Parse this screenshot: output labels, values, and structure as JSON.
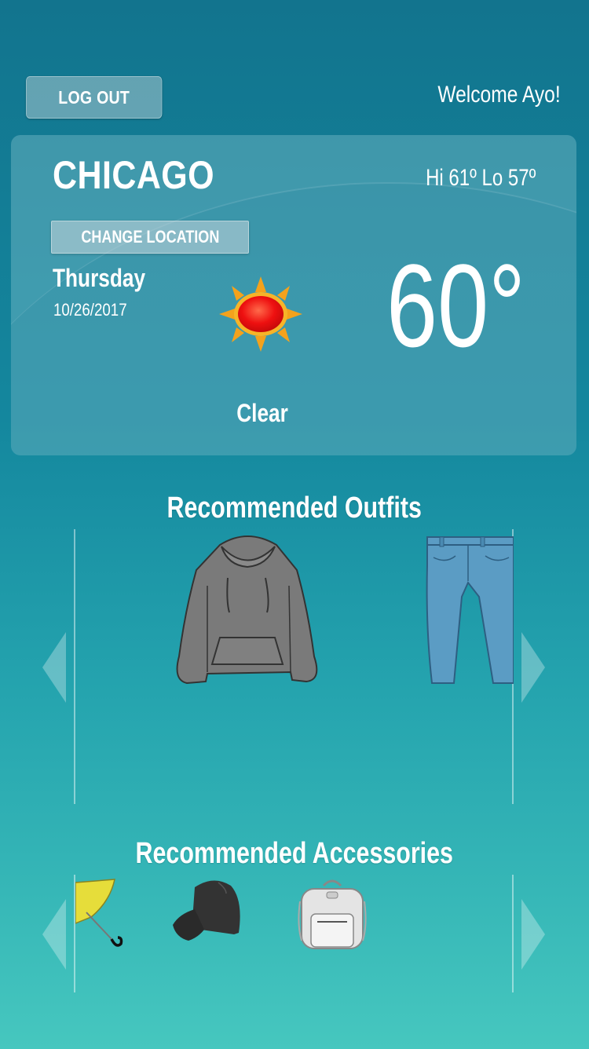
{
  "header": {
    "logout_label": "LOG OUT",
    "welcome_text": "Welcome Ayo!"
  },
  "weather": {
    "city": "CHICAGO",
    "hi_lo": "Hi 61º Lo 57º",
    "change_location_label": "CHANGE LOCATION",
    "day": "Thursday",
    "date": "10/26/2017",
    "temperature": "60°",
    "condition": "Clear",
    "icon": "sun-icon"
  },
  "outfits": {
    "title": "Recommended Outfits",
    "items": [
      {
        "name": "hoodie",
        "icon": "hoodie-icon",
        "color": "#7a7a7a"
      },
      {
        "name": "jeans",
        "icon": "jeans-icon",
        "color": "#5b9cc4"
      }
    ]
  },
  "accessories": {
    "title": "Recommended Accessories",
    "items": [
      {
        "name": "umbrella",
        "icon": "umbrella-icon",
        "color": "#e6dd3a"
      },
      {
        "name": "cap",
        "icon": "cap-icon",
        "color": "#333333"
      },
      {
        "name": "backpack",
        "icon": "backpack-icon",
        "color": "#d8d8d8"
      }
    ]
  },
  "colors": {
    "background_top": "#12748e",
    "background_bottom": "#46c7bf",
    "text": "#ffffff"
  }
}
